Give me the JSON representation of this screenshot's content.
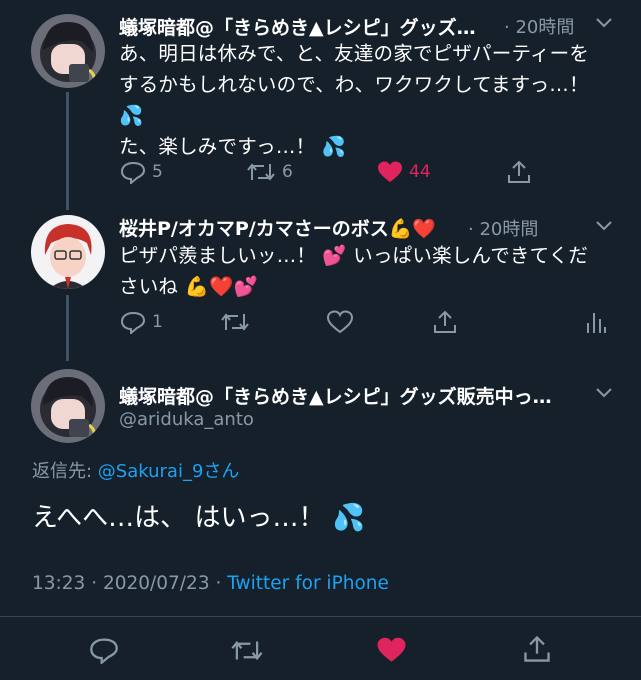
{
  "tweet1": {
    "name": "蟻塚暗都@「きらめき▲レシピ」グッズ…",
    "time": "20時間",
    "line1": "あ、明日は休みで、と、友達の家でピザパーティーを",
    "line2": "するかもしれないので、わ、ワクワクしてますっ…！",
    "line3": "💦",
    "line4": "た、楽しみですっ…！ 💦",
    "replies": "5",
    "retweets": "6",
    "likes": "44"
  },
  "tweet2": {
    "name": "桜井P/オカマP/カマさーのボス💪❤️",
    "time": "20時間",
    "line1": "ピザパ羨ましいッ…！ 💕 いっぱい楽しんできてくだ",
    "line2": "さいね 💪❤️💕",
    "replies": "1"
  },
  "main": {
    "name": "蟻塚暗都@「きらめき▲レシピ」グッズ販売中っ…",
    "handle": "@ariduka_anto",
    "reply_prefix": "返信先: ",
    "reply_to": "@Sakurai_9さん",
    "text": "えへへ…は、 はいっ…！ 💦",
    "timestamp": "13:23 · 2020/07/23 · ",
    "source": "Twitter for iPhone"
  },
  "icons": [
    "reply-icon",
    "retweet-icon",
    "like-icon",
    "share-icon",
    "analytics-icon",
    "chevron-down-icon"
  ],
  "colors": {
    "background": "#15202b",
    "secondary": "#8899a6",
    "link": "#1da1f2",
    "like": "#e0245e"
  }
}
